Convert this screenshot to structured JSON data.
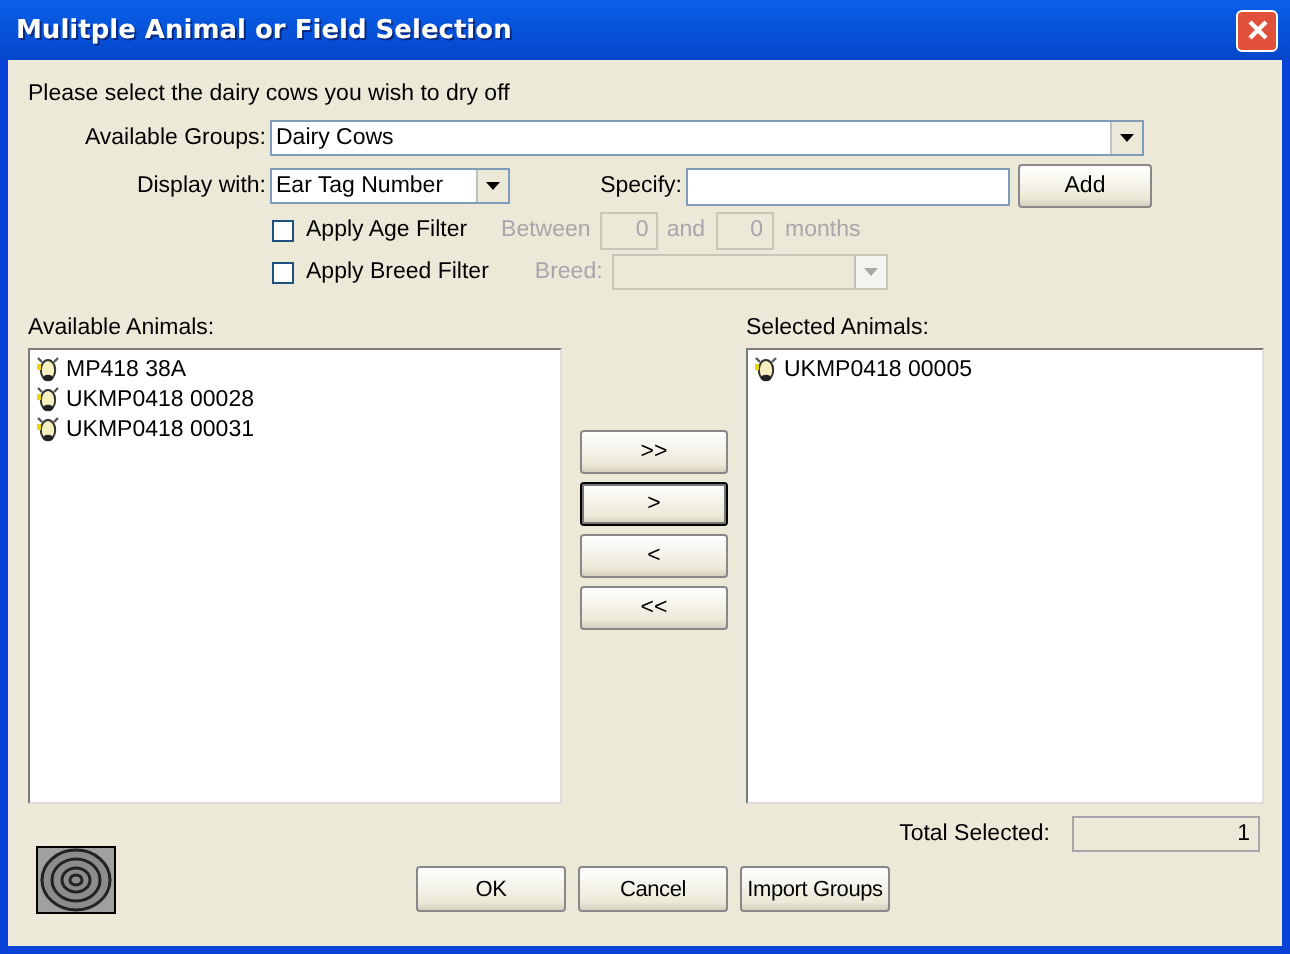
{
  "window": {
    "title": "Mulitple Animal or Field Selection"
  },
  "instruction": "Please select the dairy cows you wish to dry off",
  "available_groups": {
    "label": "Available Groups:",
    "value": "Dairy Cows"
  },
  "display_with": {
    "label": "Display with:",
    "value": "Ear Tag Number"
  },
  "specify": {
    "label": "Specify:"
  },
  "add_button": "Add",
  "age_filter": {
    "label": "Apply Age Filter",
    "checked": false,
    "disabled": true,
    "between": "Between",
    "from": "0",
    "and": "and",
    "to": "0",
    "unit": "months"
  },
  "breed_filter": {
    "label": "Apply Breed Filter",
    "checked": false,
    "disabled": true,
    "breed": "Breed:"
  },
  "available_animals": {
    "label": "Available Animals:",
    "items": [
      "MP418 38A",
      "UKMP0418 00028",
      "UKMP0418 00031"
    ]
  },
  "transfer_buttons": [
    {
      "label": ">>",
      "focused": false
    },
    {
      "label": ">",
      "focused": true
    },
    {
      "label": "<",
      "focused": false
    },
    {
      "label": "<<",
      "focused": false
    }
  ],
  "selected_animals": {
    "label": "Selected Animals:",
    "items": [
      "UKMP0418 00005"
    ]
  },
  "total_selected": {
    "label": "Total Selected:",
    "value": "1"
  },
  "buttons": [
    "OK",
    "Cancel",
    "Import Groups"
  ]
}
